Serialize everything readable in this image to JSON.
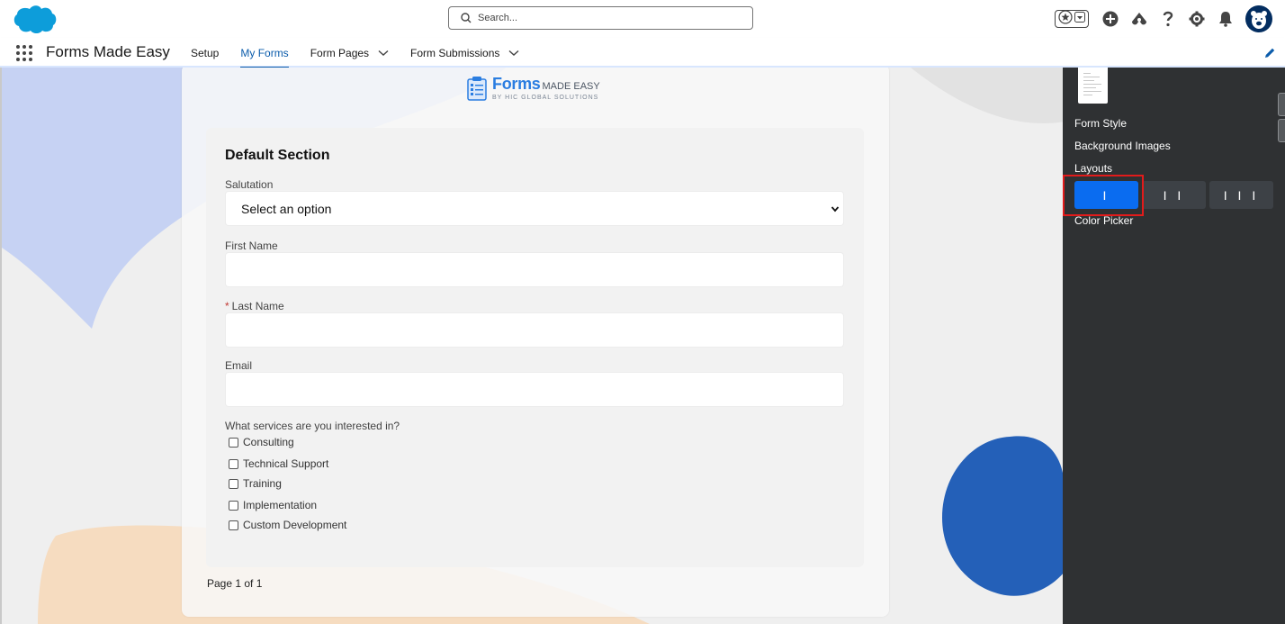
{
  "header": {
    "search_placeholder": "Search...",
    "icons": [
      "favorites-star-icon",
      "favorites-list-chevron-icon",
      "global-actions-plus-icon",
      "trailhead-icon",
      "help-icon",
      "setup-gear-icon",
      "notifications-bell-icon",
      "user-avatar-icon"
    ]
  },
  "nav": {
    "app_name": "Forms Made Easy",
    "items": [
      {
        "label": "Setup",
        "active": false,
        "has_menu": false
      },
      {
        "label": "My Forms",
        "active": true,
        "has_menu": false
      },
      {
        "label": "Form Pages",
        "active": false,
        "has_menu": true
      },
      {
        "label": "Form Submissions",
        "active": false,
        "has_menu": true
      }
    ]
  },
  "form": {
    "brand": {
      "name": "Forms",
      "name_suffix": "MADE EASY",
      "tagline": "BY HIC GLOBAL SOLUTIONS"
    },
    "section_title": "Default Section",
    "fields": {
      "salutation": {
        "label": "Salutation",
        "value": "Select an option"
      },
      "first_name": {
        "label": "First Name",
        "value": ""
      },
      "last_name": {
        "label": "Last Name",
        "required_marker": "*",
        "value": ""
      },
      "email": {
        "label": "Email",
        "value": ""
      }
    },
    "services": {
      "label": "What services are you interested in?",
      "options": [
        "Consulting",
        "Technical Support",
        "Training",
        "Implementation",
        "Custom Development"
      ]
    },
    "page_count": "Page 1 of 1"
  },
  "panel": {
    "form_style": "Form Style",
    "background_images": "Background Images",
    "layouts": "Layouts",
    "layout_options": [
      "I",
      "I I",
      "I I I"
    ],
    "selected_layout": "I",
    "color_picker": "Color Picker"
  },
  "colors": {
    "brand_blue": "#0b5cab",
    "layout_selected": "#0a6cf0",
    "panel_bg": "#2f3133",
    "highlight_red": "#e21b1b",
    "bg_blob_blue": "#2460b8",
    "bg_blob_peach": "#f6dcc0",
    "bg_blob_lavender": "#c6d2f3"
  }
}
